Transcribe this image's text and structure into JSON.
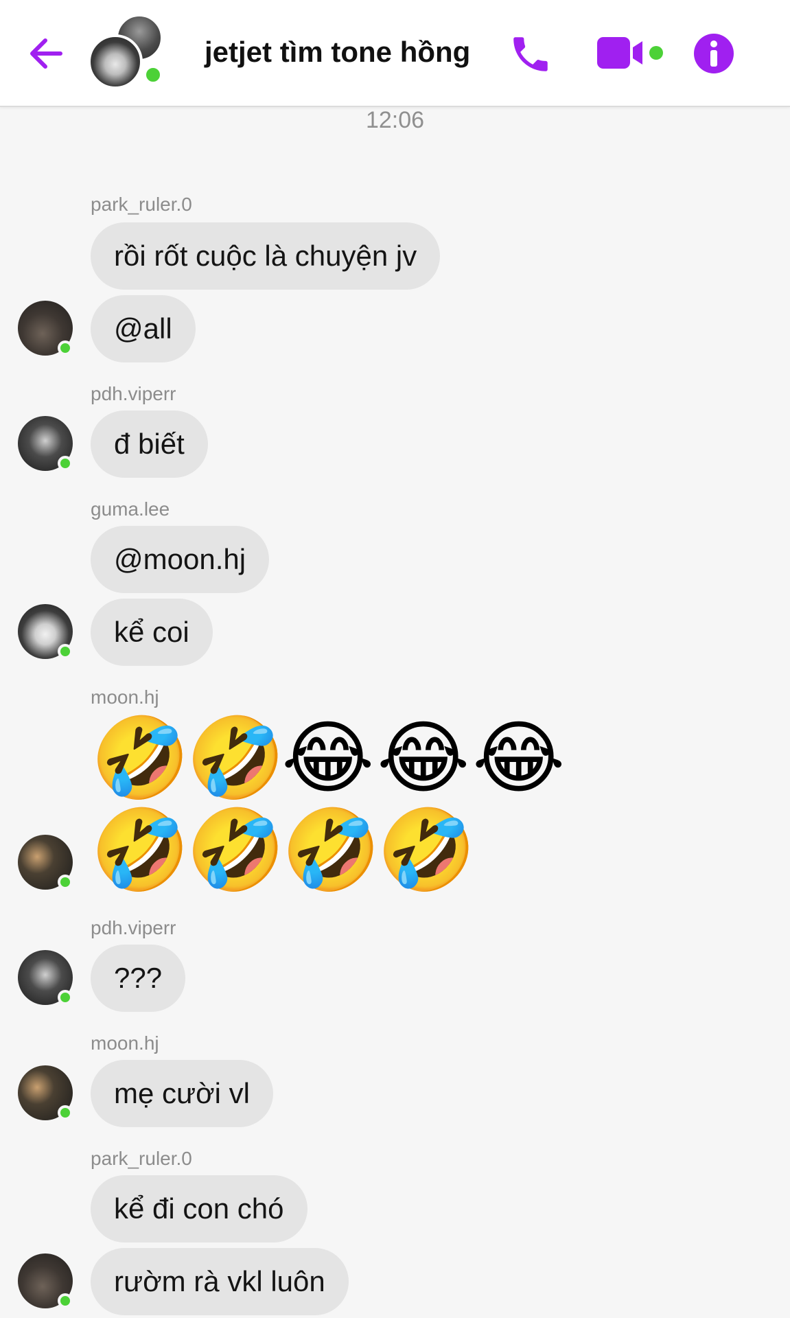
{
  "header": {
    "title": "jetjet tìm tone hồng",
    "back_icon": "arrow-left-icon",
    "call_icon": "phone-icon",
    "video_icon": "video-camera-icon",
    "info_icon": "info-icon",
    "accent_color": "#a020f0",
    "online_color": "#4cd137"
  },
  "timestamp": "12:06",
  "messages": [
    {
      "sender": "park_ruler.0",
      "bubbles": [
        "rồi rốt cuộc là chuyện jv",
        "@all"
      ]
    },
    {
      "sender": "pdh.viperr",
      "bubbles": [
        "đ biết"
      ]
    },
    {
      "sender": "guma.lee",
      "bubbles": [
        "@moon.hj",
        "kể coi"
      ]
    },
    {
      "sender": "moon.hj",
      "emoji_rows": [
        [
          "🤣",
          "🤣",
          "😂",
          "😂",
          "😂"
        ],
        [
          "🤣",
          "🤣",
          "🤣",
          "🤣"
        ]
      ]
    },
    {
      "sender": "pdh.viperr",
      "bubbles": [
        "???"
      ]
    },
    {
      "sender": "moon.hj",
      "bubbles": [
        "mẹ cười vl"
      ]
    },
    {
      "sender": "park_ruler.0",
      "bubbles": [
        "kể đi con chó",
        "rườm rà vkl luôn"
      ]
    }
  ]
}
